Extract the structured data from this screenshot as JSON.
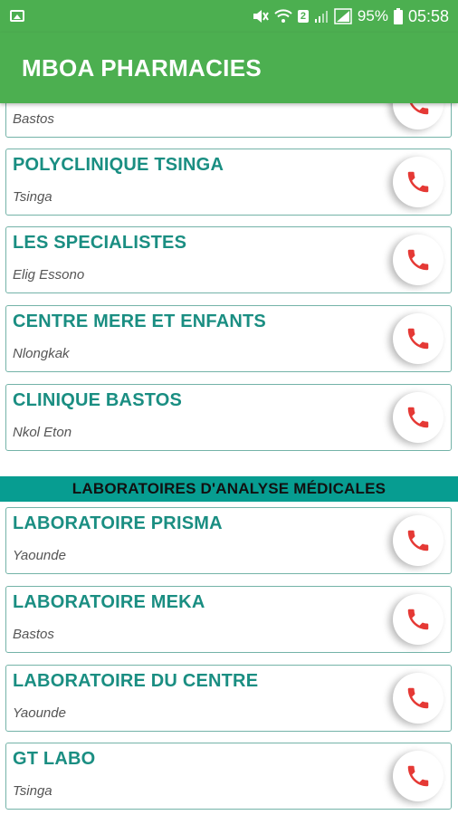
{
  "status_bar": {
    "battery": "95%",
    "time": "05:58",
    "sim_badge": "2"
  },
  "app": {
    "title": "MBOA PHARMACIES"
  },
  "top_card": {
    "location": "Bastos"
  },
  "clinics": [
    {
      "name": "POLYCLINIQUE TSINGA",
      "location": "Tsinga"
    },
    {
      "name": "LES SPECIALISTES",
      "location": "Elig Essono"
    },
    {
      "name": "CENTRE MERE ET ENFANTS",
      "location": "Nlongkak"
    },
    {
      "name": "CLINIQUE BASTOS",
      "location": "Nkol Eton"
    }
  ],
  "section": {
    "title": "LABORATOIRES D'ANALYSE MÉDICALES"
  },
  "labs": [
    {
      "name": "LABORATOIRE PRISMA",
      "location": "Yaounde"
    },
    {
      "name": "LABORATOIRE MEKA",
      "location": "Bastos"
    },
    {
      "name": "LABORATOIRE DU CENTRE",
      "location": "Yaounde"
    },
    {
      "name": "GT LABO",
      "location": "Tsinga"
    }
  ],
  "colors": {
    "primary": "#4caf50",
    "accent_text": "#1a8e82",
    "section_bg": "#079d91",
    "phone_icon": "#e53935"
  },
  "icons": {
    "call": "phone-icon"
  }
}
